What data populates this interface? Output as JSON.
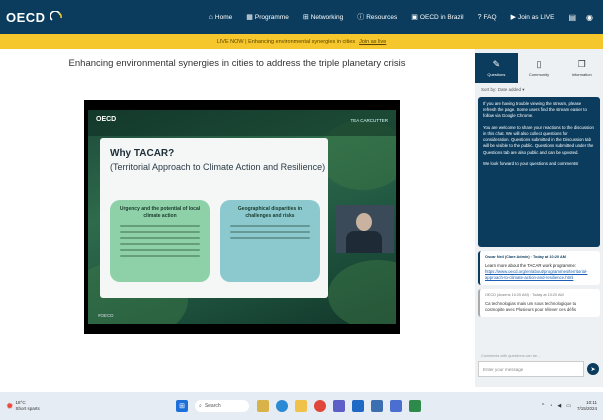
{
  "topnav": {
    "logo": "OECD",
    "items": [
      {
        "icon": "home-icon",
        "glyph": "⌂",
        "label": "Home"
      },
      {
        "icon": "calendar-icon",
        "glyph": "▦",
        "label": "Programme"
      },
      {
        "icon": "network-icon",
        "glyph": "⊞",
        "label": "Networking"
      },
      {
        "icon": "info-icon",
        "glyph": "ⓘ",
        "label": "Resources"
      },
      {
        "icon": "building-icon",
        "glyph": "▣",
        "label": "OECD in Brazil"
      },
      {
        "icon": "question-icon",
        "glyph": "?",
        "label": "FAQ"
      },
      {
        "icon": "play-icon",
        "glyph": "▶",
        "label": "Join as LIVE"
      }
    ]
  },
  "banner": {
    "text": "LIVE NOW | Enhancing environmental synergies in cities",
    "link": "Join as live"
  },
  "main": {
    "title": "Enhancing environmental synergies in cities to address the triple planetary crisis"
  },
  "slide": {
    "logo": "OECD",
    "tag": "TEA CARCUTTER",
    "heading": "Why TACAR?",
    "subheading": "(Territorial Approach to Climate Action and Resilience)",
    "box1_title": "Urgency and the potential of local climate action",
    "box2_title": "Geographical disparities in challenges and risks",
    "footer": "#OECD"
  },
  "panel": {
    "tabs": [
      {
        "icon": "chat-icon",
        "glyph": "✎",
        "label": "Questions"
      },
      {
        "icon": "document-icon",
        "glyph": "▯",
        "label": "Community"
      },
      {
        "icon": "file-icon",
        "glyph": "❐",
        "label": "Information"
      }
    ],
    "sort_by": "Sort by: Date added ▾",
    "system_msg": [
      "If you are having trouble viewing the stream, please refresh the page. Some users find the stream easier to follow via Google Chrome.",
      "You are welcome to share your reactions to the discussion in this chat. We will also collect questions for consideration. Questions submitted in the Discussion tab will be visible to the public. Questions submitted under the Questions tab are also public and can be upvoted.",
      "We look forward to your questions and comments!"
    ],
    "msg2_head": "Oscar Neil (Clare Admin) · Today at 10:20 AM",
    "msg2_text": "Learn more about the TACAR work programme:",
    "msg2_link": "https://www.oecd.org/en/about/programmes/territorial-approach-to-climate-action-and-resilience.html",
    "msg3_head": "OECD (dozens 10:20 AM) · Today at 10:20 AM",
    "msg3_text": "Ca technologias mais um sous technologique tu cosmopite avec Plusieurs pour rélever ces défis",
    "hint": "Comments with questions can be... ",
    "input_placeholder": "Enter your message"
  },
  "taskbar": {
    "weather_temp": "18°C",
    "weather_text": "Short sparts",
    "search_placeholder": "Search",
    "clock_time": "10:11",
    "clock_date": "7/15/2024"
  }
}
